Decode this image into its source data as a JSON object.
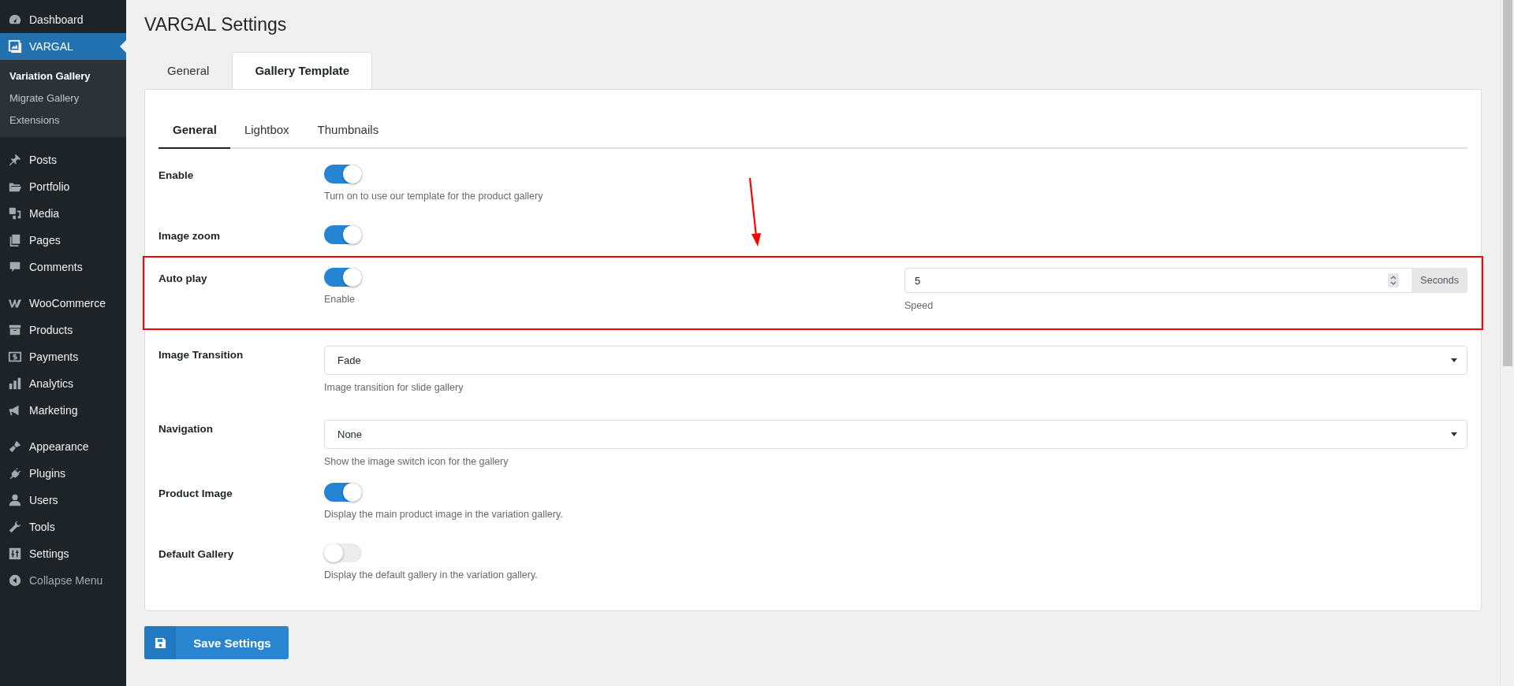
{
  "sidebar": {
    "groups": [
      {
        "items": [
          {
            "label": "Dashboard",
            "selected": false
          },
          {
            "label": "VARGAL",
            "selected": true,
            "children": [
              {
                "label": "Variation Gallery",
                "selected": true
              },
              {
                "label": "Migrate Gallery",
                "selected": false
              },
              {
                "label": "Extensions",
                "selected": false
              }
            ]
          }
        ]
      },
      {
        "items": [
          {
            "label": "Posts",
            "selected": false
          },
          {
            "label": "Portfolio",
            "selected": false
          },
          {
            "label": "Media",
            "selected": false
          },
          {
            "label": "Pages",
            "selected": false
          },
          {
            "label": "Comments",
            "selected": false
          }
        ]
      },
      {
        "items": [
          {
            "label": "WooCommerce",
            "selected": false
          },
          {
            "label": "Products",
            "selected": false
          },
          {
            "label": "Payments",
            "selected": false
          },
          {
            "label": "Analytics",
            "selected": false
          },
          {
            "label": "Marketing",
            "selected": false
          }
        ]
      },
      {
        "items": [
          {
            "label": "Appearance",
            "selected": false
          },
          {
            "label": "Plugins",
            "selected": false
          },
          {
            "label": "Users",
            "selected": false
          },
          {
            "label": "Tools",
            "selected": false
          },
          {
            "label": "Settings",
            "selected": false
          },
          {
            "label": "Collapse Menu",
            "selected": false,
            "kind": "collapse"
          }
        ]
      }
    ]
  },
  "page": {
    "title": "VARGAL Settings",
    "tabs": [
      {
        "label": "General",
        "selected": false
      },
      {
        "label": "Gallery Template",
        "selected": true
      }
    ],
    "subtabs": [
      {
        "label": "General",
        "selected": true
      },
      {
        "label": "Lightbox",
        "selected": false
      },
      {
        "label": "Thumbnails",
        "selected": false
      }
    ],
    "rows": [
      {
        "kind": "toggle",
        "label": "Enable",
        "on": true,
        "hint": "Turn on to use our template for the product gallery"
      },
      {
        "kind": "toggle",
        "label": "Image zoom",
        "on": true
      },
      {
        "kind": "toggle_number",
        "label": "Auto play",
        "on": true,
        "hint": "Enable",
        "number": {
          "value": "5",
          "unit": "Seconds",
          "hint": "Speed"
        },
        "highlighted": true
      },
      {
        "kind": "select",
        "label": "Image Transition",
        "value": "Fade",
        "hint": "Image transition for slide gallery"
      },
      {
        "kind": "select",
        "label": "Navigation",
        "value": "None",
        "hint": "Show the image switch icon for the gallery"
      },
      {
        "kind": "toggle",
        "label": "Product Image",
        "on": true,
        "hint": "Display the main product image in the variation gallery."
      },
      {
        "kind": "toggle",
        "label": "Default Gallery",
        "on": false,
        "hint": "Display the default gallery in the variation gallery."
      }
    ],
    "save_button": "Save Settings"
  }
}
